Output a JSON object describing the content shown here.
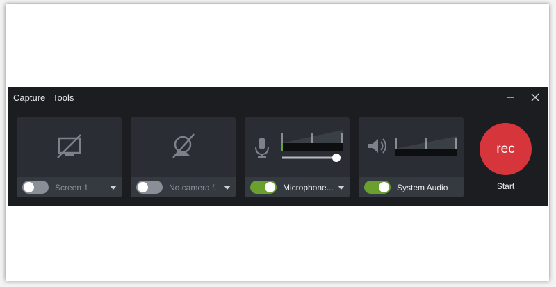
{
  "menu": {
    "capture": "Capture",
    "tools": "Tools"
  },
  "window": {
    "minimize_icon": "minimize-icon",
    "close_icon": "close-icon"
  },
  "panels": {
    "screen": {
      "icon": "screen-disabled-icon",
      "label": "Screen 1",
      "enabled": false
    },
    "camera": {
      "icon": "camera-disabled-icon",
      "label": "No camera f...",
      "enabled": false
    },
    "microphone": {
      "icon": "microphone-icon",
      "label": "Microphone...",
      "enabled": true,
      "volume_level": 1.0
    },
    "system_audio": {
      "icon": "speaker-icon",
      "label": "System Audio",
      "enabled": true
    }
  },
  "record": {
    "button_label": "rec",
    "start_label": "Start"
  },
  "colors": {
    "accent_green": "#6aa12e",
    "record_red": "#d5353b",
    "background": "#1b1d21",
    "panel": "#2a2d33"
  }
}
